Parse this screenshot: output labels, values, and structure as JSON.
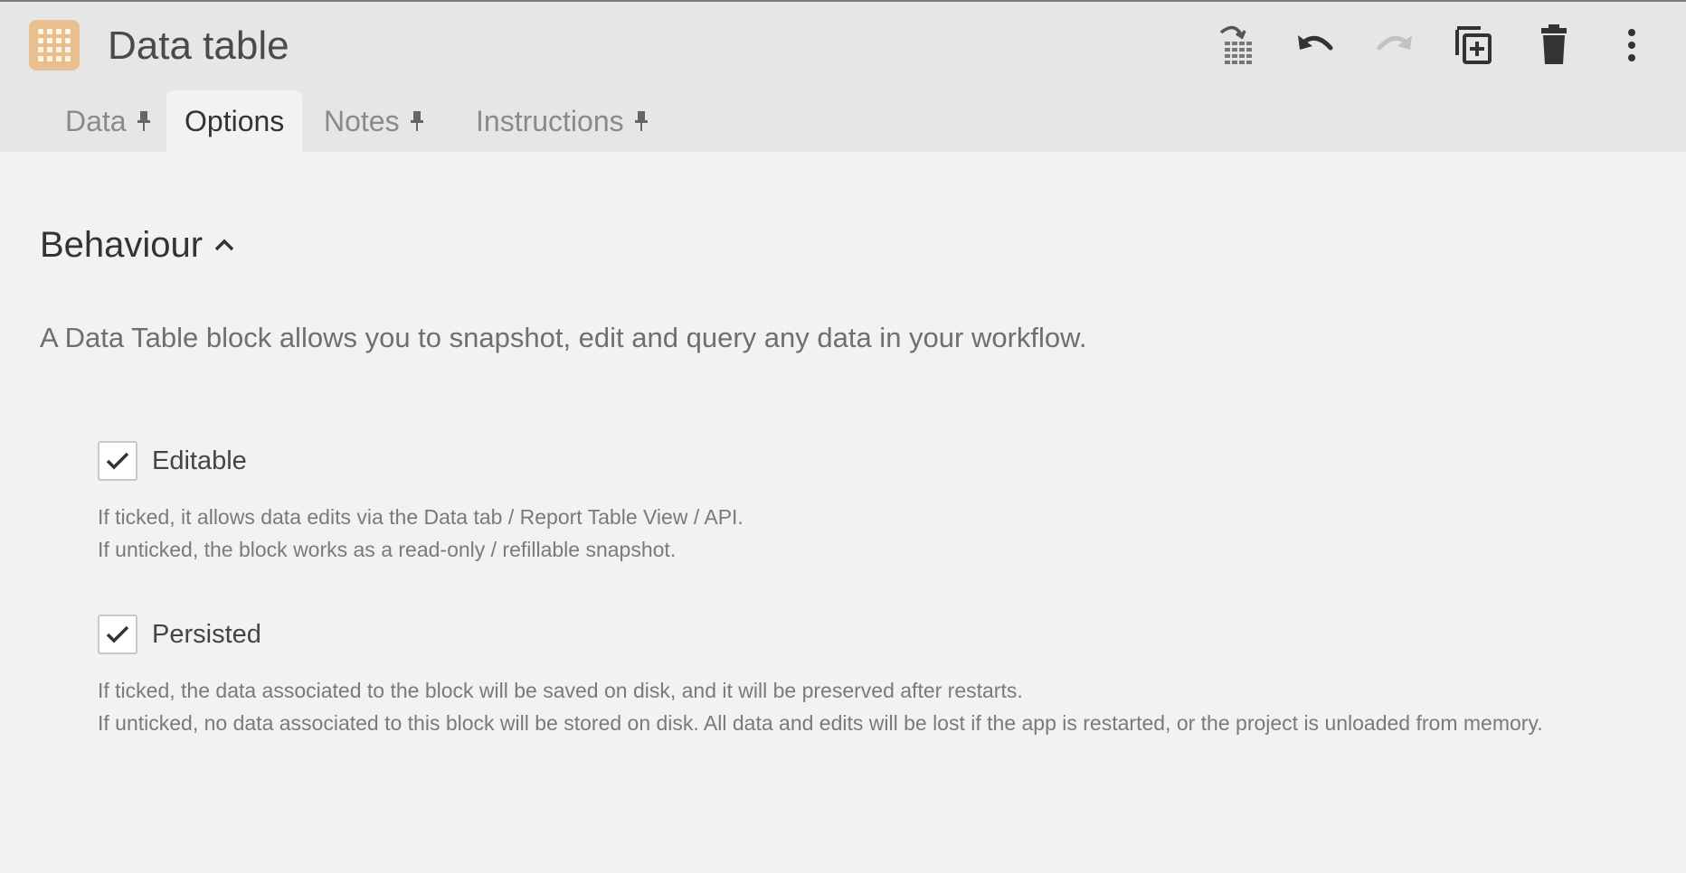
{
  "header": {
    "title": "Data table",
    "app_icon": "data-table-grid-icon",
    "accent_color": "#e8c08f"
  },
  "toolbar": {
    "buttons": [
      {
        "name": "refresh-data-icon",
        "enabled": true
      },
      {
        "name": "undo-icon",
        "enabled": true
      },
      {
        "name": "redo-icon",
        "enabled": false
      },
      {
        "name": "duplicate-icon",
        "enabled": true
      },
      {
        "name": "trash-icon",
        "enabled": true
      },
      {
        "name": "more-vertical-icon",
        "enabled": true
      }
    ]
  },
  "tabs": [
    {
      "label": "Data",
      "pinned": true,
      "active": false
    },
    {
      "label": "Options",
      "pinned": false,
      "active": true
    },
    {
      "label": "Notes",
      "pinned": true,
      "active": false
    },
    {
      "label": "Instructions",
      "pinned": true,
      "active": false
    }
  ],
  "section": {
    "title": "Behaviour",
    "expanded": true,
    "description": "A Data Table block allows you to snapshot, edit and query any data in your workflow."
  },
  "options": [
    {
      "label": "Editable",
      "checked": true,
      "help": [
        "If ticked, it allows data edits via the Data tab / Report Table View / API.",
        "If unticked, the block works as a read-only / refillable snapshot."
      ]
    },
    {
      "label": "Persisted",
      "checked": true,
      "help": [
        "If ticked, the data associated to the block will be saved on disk, and it will be preserved after restarts.",
        "If unticked, no data associated to this block will be stored on disk. All data and edits will be lost if the app is restarted, or the project is unloaded from memory."
      ]
    }
  ]
}
